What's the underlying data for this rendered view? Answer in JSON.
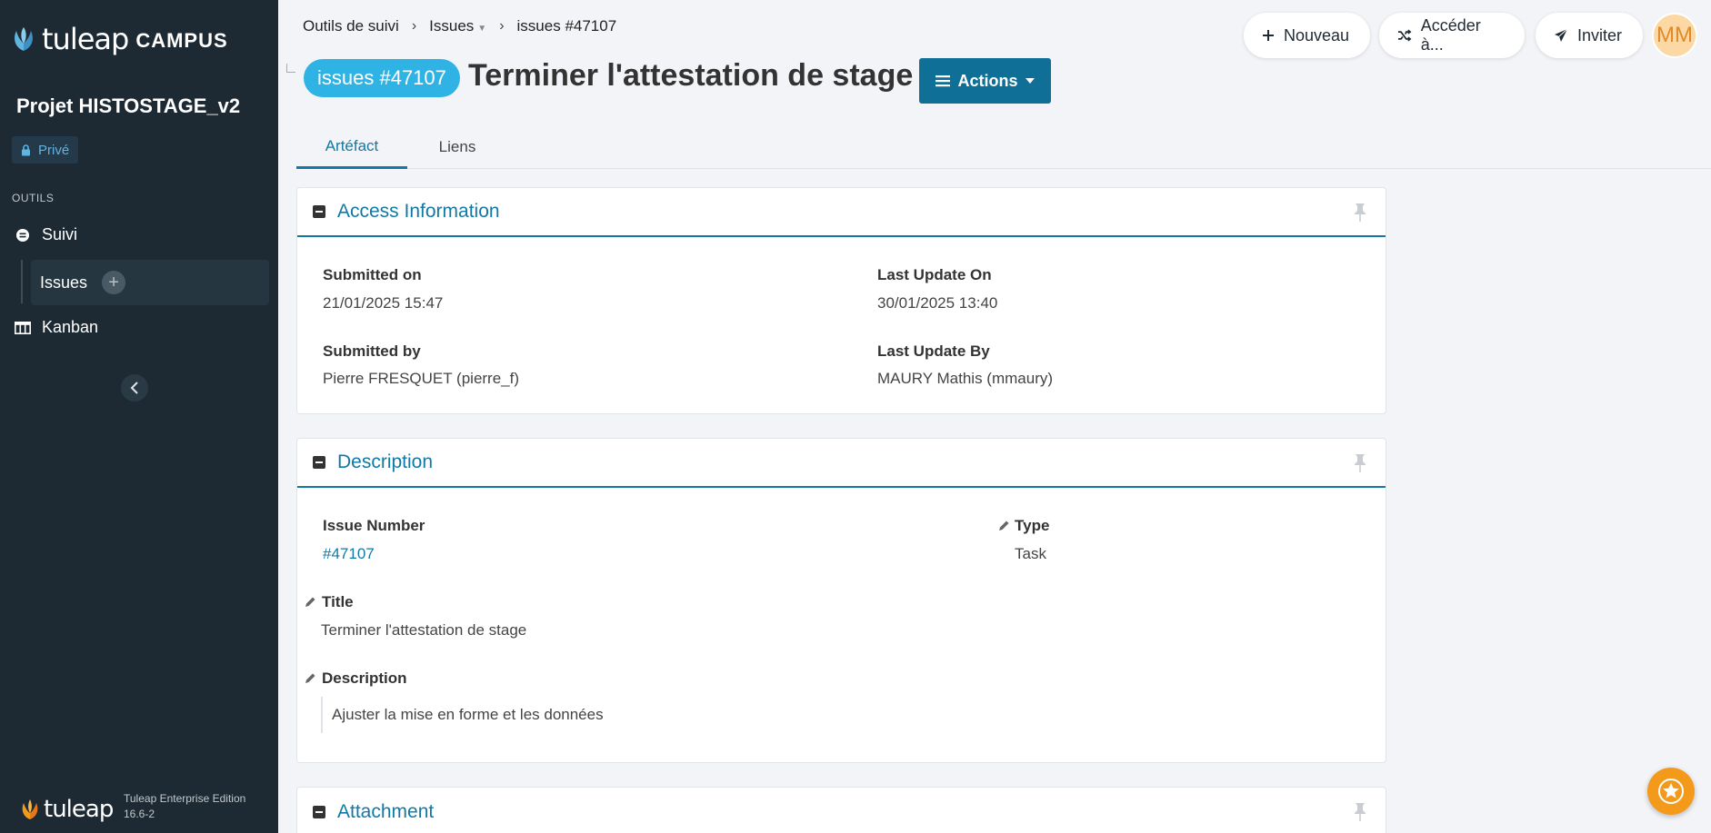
{
  "sidebar": {
    "logo_text": "tuleap",
    "logo_campus": "CAMPUS",
    "project_name": "Projet HISTOSTAGE_v2",
    "privacy": "Privé",
    "section_label": "OUTILS",
    "items": [
      {
        "label": "Suivi",
        "icon": "tracker-icon"
      },
      {
        "label": "Issues",
        "icon": "plus-icon"
      },
      {
        "label": "Kanban",
        "icon": "kanban-icon"
      }
    ],
    "footer_logo": "tuleap",
    "footer_edition": "Tuleap Enterprise Edition",
    "footer_version": "16.6-2"
  },
  "header": {
    "breadcrumb": [
      "Outils de suivi",
      "Issues",
      "issues #47107"
    ],
    "buttons": {
      "new": "Nouveau",
      "goto": "Accéder à...",
      "invite": "Inviter"
    },
    "avatar_initials": "MM"
  },
  "artifact": {
    "badge": "issues #47107",
    "title": "Terminer l'attestation de stage",
    "actions_label": "Actions"
  },
  "tabs": [
    {
      "label": "Artéfact",
      "active": true
    },
    {
      "label": "Liens",
      "active": false
    }
  ],
  "access_info": {
    "title": "Access Information",
    "submitted_on_label": "Submitted on",
    "submitted_on": "21/01/2025 15:47",
    "last_update_on_label": "Last Update On",
    "last_update_on": "30/01/2025 13:40",
    "submitted_by_label": "Submitted by",
    "submitted_by": "Pierre FRESQUET (pierre_f)",
    "last_update_by_label": "Last Update By",
    "last_update_by": "MAURY Mathis (mmaury)"
  },
  "description_panel": {
    "title": "Description",
    "issue_number_label": "Issue Number",
    "issue_number": "#47107",
    "type_label": "Type",
    "type": "Task",
    "title_label": "Title",
    "title_value": "Terminer l'attestation de stage",
    "description_label": "Description",
    "description_value": "Ajuster la mise en forme et les données"
  },
  "attachment_panel": {
    "title": "Attachment"
  },
  "colors": {
    "sidebar_bg": "#1d2a33",
    "accent": "#1179a6",
    "badge": "#2fb3e4",
    "fab": "#f39a1b"
  }
}
